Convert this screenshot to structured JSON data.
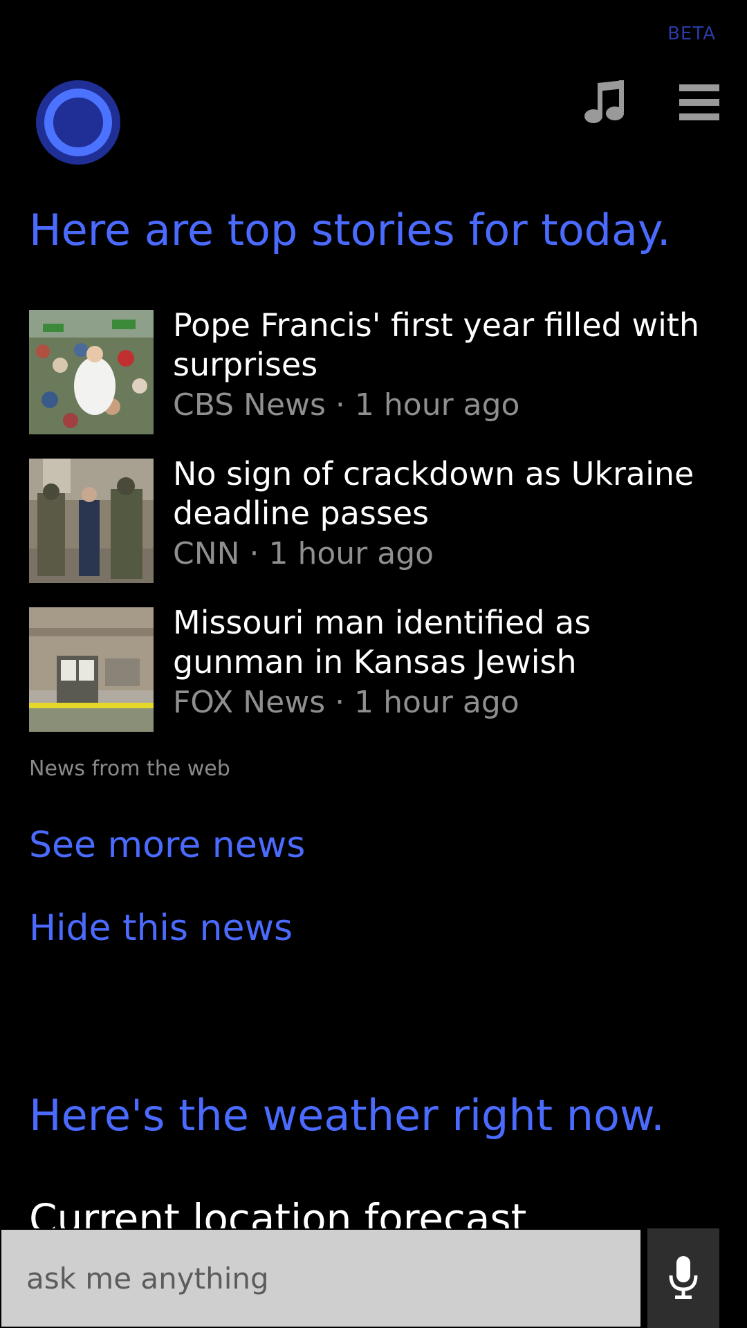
{
  "header": {
    "beta_label": "BETA",
    "icons": [
      "cortana-logo",
      "music-icon",
      "menu-icon"
    ]
  },
  "news": {
    "heading": "Here are top stories for today.",
    "stories": [
      {
        "title": "Pope Francis' first year filled with surprises",
        "source": "CBS News",
        "time": "1 hour ago",
        "meta": "CBS News · 1 hour ago"
      },
      {
        "title": "No sign of crackdown as Ukraine deadline passes",
        "source": "CNN",
        "time": "1 hour ago",
        "meta": "CNN · 1 hour ago"
      },
      {
        "title": "Missouri man identified as gunman in Kansas Jewish",
        "source": "FOX News",
        "time": "1 hour ago",
        "meta": "FOX News · 1 hour ago"
      }
    ],
    "source_note": "News from the web",
    "see_more_label": "See more news",
    "hide_label": "Hide this news"
  },
  "weather": {
    "heading": "Here's the weather right now.",
    "forecast_title": "Current location forecast"
  },
  "search": {
    "placeholder": "ask me anything"
  },
  "colors": {
    "accent": "#4b6bff",
    "background": "#000000",
    "meta_text": "#8f8f8f",
    "search_field": "#cfcfcf"
  }
}
